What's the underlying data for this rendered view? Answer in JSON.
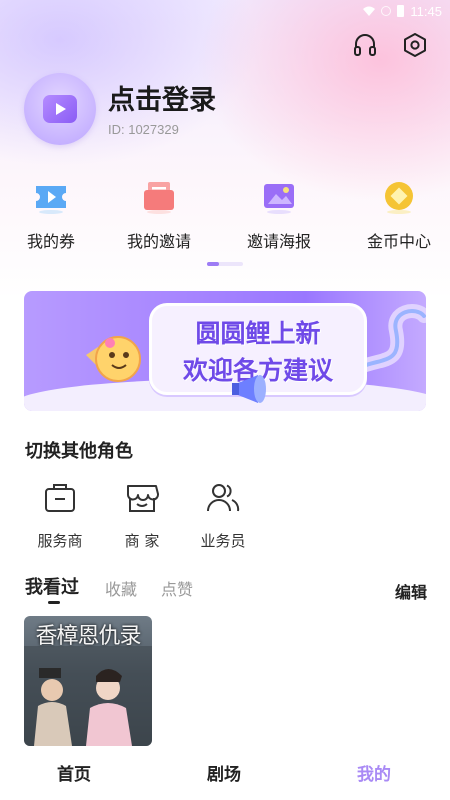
{
  "status_bar": {
    "time": "11:45"
  },
  "header": {
    "title": "点击登录",
    "user_id": "ID: 1027329"
  },
  "icons": {
    "headset": "headset-icon",
    "settings": "hexagon-settings-icon"
  },
  "quick_links": [
    {
      "label": "我的券",
      "icon": "ticket-icon",
      "color": "#5aa9f5"
    },
    {
      "label": "我的邀请",
      "icon": "mail-invite-icon",
      "color": "#f57b7b"
    },
    {
      "label": "邀请海报",
      "icon": "poster-image-icon",
      "color": "#9a6ef7"
    },
    {
      "label": "金币中心",
      "icon": "coin-icon",
      "color": "#f5c435"
    }
  ],
  "banner": {
    "line1": "圆圆鲤上新",
    "line2": "欢迎各方建议"
  },
  "roles": {
    "title": "切换其他角色",
    "items": [
      {
        "label": "服务商",
        "icon": "briefcase-icon"
      },
      {
        "label": "商 家",
        "icon": "store-icon"
      },
      {
        "label": "业务员",
        "icon": "users-icon"
      }
    ]
  },
  "history": {
    "tabs": [
      "我看过",
      "收藏",
      "点赞"
    ],
    "active_tab": 0,
    "edit_label": "编辑",
    "items": [
      {
        "poster_title": "香樟恩仇录"
      }
    ]
  },
  "bottom_nav": {
    "items": [
      "首页",
      "剧场",
      "我的"
    ],
    "active": 2
  },
  "colors": {
    "accent": "#a98af5",
    "avatar": "#c7b3ff"
  }
}
